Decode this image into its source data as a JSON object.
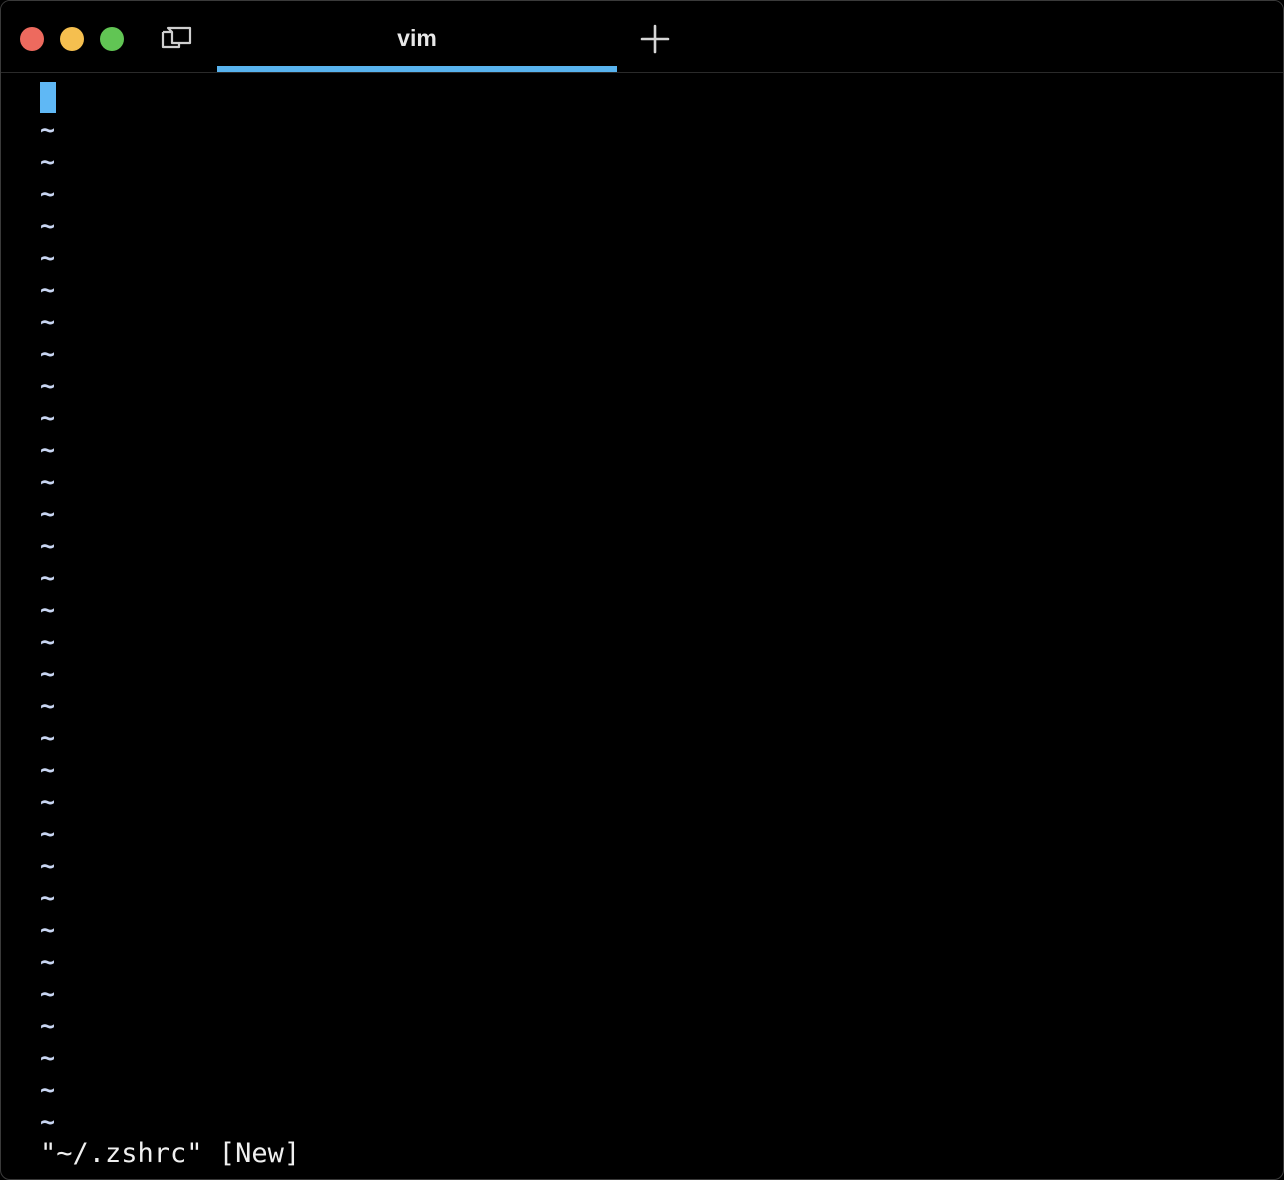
{
  "window": {
    "tab_title": "vim",
    "accent_color": "#58b3ee"
  },
  "icons": {
    "close": "close-circle",
    "minimize": "minimize-circle",
    "maximize": "maximize-circle",
    "tab_overview": "tab-overview-icon",
    "new_tab": "plus-icon"
  },
  "editor": {
    "empty_line_marker": "~",
    "empty_line_count": 32,
    "cursor_color": "#5fb8f5"
  },
  "status": {
    "message": "\"~/.zshrc\" [New]"
  }
}
